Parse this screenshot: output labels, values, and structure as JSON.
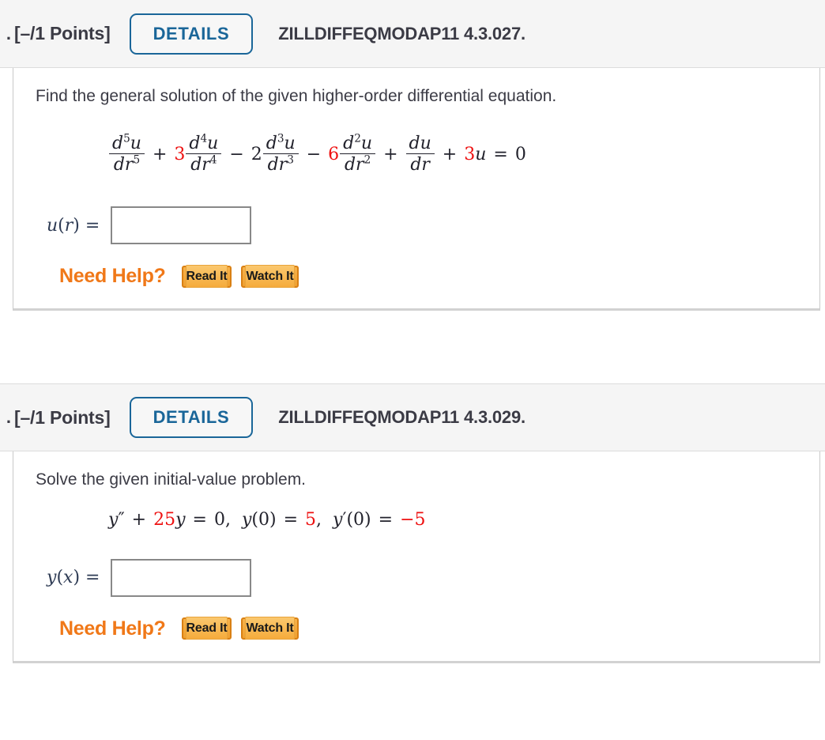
{
  "problems": [
    {
      "marker": ".",
      "points": "[–/1 Points]",
      "details_label": "DETAILS",
      "question_id": "ZILLDIFFEQMODAP11 4.3.027.",
      "prompt": "Find the general solution of the given higher-order differential equation.",
      "equation": {
        "text": "d⁵u/dr⁵ + 3 d⁴u/dr⁴ − 2 d³u/dr³ − 6 d²u/dr² + du/dr + 3u = 0",
        "terms": [
          {
            "coefficient": "",
            "numerator": "d",
            "num_sup": "5",
            "num_var": "u",
            "denominator": "dr",
            "den_sup": "5",
            "operator": ""
          },
          {
            "coefficient": "3",
            "coefficient_color": "red",
            "numerator": "d",
            "num_sup": "4",
            "num_var": "u",
            "denominator": "dr",
            "den_sup": "4",
            "operator": "+"
          },
          {
            "coefficient": "2",
            "coefficient_color": "black",
            "numerator": "d",
            "num_sup": "3",
            "num_var": "u",
            "denominator": "dr",
            "den_sup": "3",
            "operator": "−"
          },
          {
            "coefficient": "6",
            "coefficient_color": "red",
            "numerator": "d",
            "num_sup": "2",
            "num_var": "u",
            "denominator": "dr",
            "den_sup": "2",
            "operator": "−"
          },
          {
            "coefficient": "",
            "numerator": "d",
            "num_sup": "",
            "num_var": "u",
            "denominator": "dr",
            "den_sup": "",
            "operator": "+"
          }
        ],
        "tail_operator": "+",
        "tail_coefficient": "3",
        "tail_variable": "u",
        "equals": "=",
        "rhs": "0"
      },
      "answer_label_func": "u",
      "answer_label_arg": "r",
      "answer_label_eq": "=",
      "answer_value": "",
      "need_help_label": "Need Help?",
      "read_it_label": "Read It",
      "watch_it_label": "Watch It"
    },
    {
      "marker": ".",
      "points": "[–/1 Points]",
      "details_label": "DETAILS",
      "question_id": "ZILLDIFFEQMODAP11 4.3.029.",
      "prompt": "Solve the given initial-value problem.",
      "ivp": {
        "text": "y″ + 25y = 0,  y(0) = 5,  y′(0) = −5",
        "lhs_var": "y",
        "lhs_primes": "″",
        "plus": "+",
        "coefficient": "25",
        "coefficient_color": "red",
        "coefficient_var": "y",
        "equals1": "=",
        "rhs1": "0",
        "comma1": ",",
        "ic1_func": "y",
        "ic1_arg": "(0)",
        "equals2": "=",
        "ic1_value": "5",
        "ic1_value_color": "red",
        "comma2": ",",
        "ic2_func": "y",
        "ic2_primes": "′",
        "ic2_arg": "(0)",
        "equals3": "=",
        "ic2_value": "−5",
        "ic2_value_color": "red"
      },
      "answer_label_func": "y",
      "answer_label_arg": "x",
      "answer_label_eq": "=",
      "answer_value": "",
      "need_help_label": "Need Help?",
      "read_it_label": "Read It",
      "watch_it_label": "Watch It"
    }
  ],
  "colors": {
    "accent_blue": "#1a6699",
    "math_red": "#ee1111",
    "help_orange": "#f07818",
    "text": "#3b3b45",
    "header_bg": "#f5f5f5"
  }
}
